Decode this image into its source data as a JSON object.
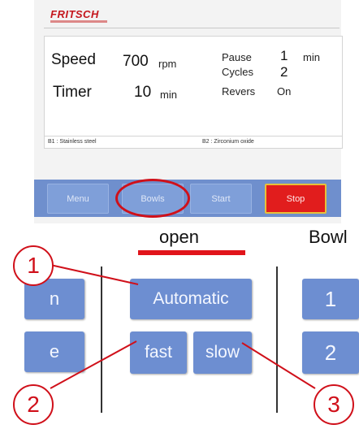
{
  "header": {
    "brand": "FRITSCH"
  },
  "params": {
    "speed_label": "Speed",
    "speed_value": "700",
    "speed_unit": "rpm",
    "timer_label": "Timer",
    "timer_value": "10",
    "timer_unit": "min",
    "pause_label": "Pause",
    "pause_value": "1",
    "pause_unit": "min",
    "cycles_label": "Cycles",
    "cycles_value": "2",
    "revers_label": "Revers",
    "revers_value": "On"
  },
  "bowls": {
    "b1": "B1 : Stainless steel",
    "b2": "B2 : Zirconium oxide"
  },
  "bar": {
    "menu": "Menu",
    "bowls": "Bowls",
    "start": "Start",
    "stop": "Stop"
  },
  "lower": {
    "open_label": "open",
    "bowl_label": "Bowl",
    "left_top_partial": "n",
    "left_bottom_partial": "e",
    "automatic": "Automatic",
    "fast": "fast",
    "slow": "slow",
    "bowl_1": "1",
    "bowl_2": "2"
  },
  "callouts": {
    "c1": "1",
    "c2": "2",
    "c3": "3"
  },
  "colors": {
    "accent_red": "#d0101a",
    "button_blue": "#6d8ed1",
    "stop_red": "#e11d1d"
  }
}
